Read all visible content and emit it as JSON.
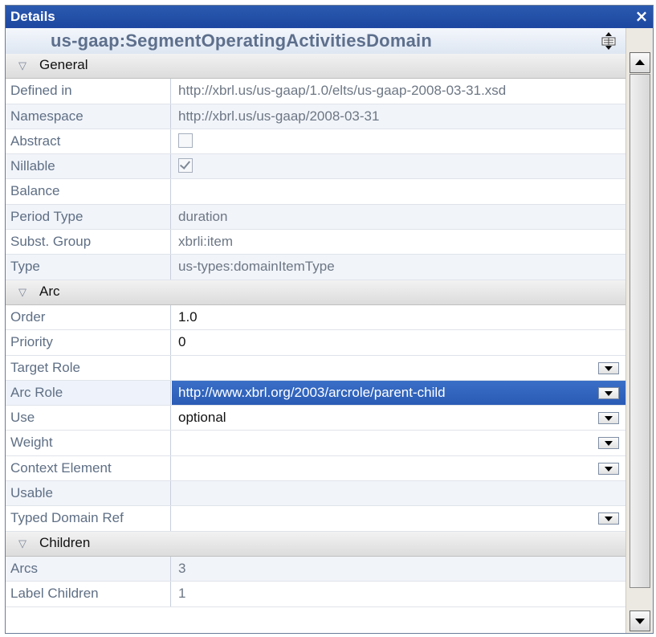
{
  "window": {
    "title": "Details",
    "close_glyph": "×"
  },
  "element_name": "us-gaap:SegmentOperatingActivitiesDomain",
  "groups": {
    "general": "General",
    "arc": "Arc",
    "children": "Children"
  },
  "general": {
    "defined_in": {
      "label": "Defined in",
      "value": "http://xbrl.us/us-gaap/1.0/elts/us-gaap-2008-03-31.xsd"
    },
    "namespace": {
      "label": "Namespace",
      "value": "http://xbrl.us/us-gaap/2008-03-31"
    },
    "abstract": {
      "label": "Abstract",
      "checked": false
    },
    "nillable": {
      "label": "Nillable",
      "checked": true
    },
    "balance": {
      "label": "Balance",
      "value": ""
    },
    "period_type": {
      "label": "Period Type",
      "value": "duration"
    },
    "subst_group": {
      "label": "Subst. Group",
      "value": "xbrli:item"
    },
    "type": {
      "label": "Type",
      "value": "us-types:domainItemType"
    }
  },
  "arc": {
    "order": {
      "label": "Order",
      "value": "1.0"
    },
    "priority": {
      "label": "Priority",
      "value": "0"
    },
    "target_role": {
      "label": "Target Role",
      "value": ""
    },
    "arc_role": {
      "label": "Arc Role",
      "value": "http://www.xbrl.org/2003/arcrole/parent-child"
    },
    "use": {
      "label": "Use",
      "value": "optional"
    },
    "weight": {
      "label": "Weight",
      "value": ""
    },
    "context_element": {
      "label": "Context Element",
      "value": ""
    },
    "usable": {
      "label": "Usable",
      "value": ""
    },
    "typed_domain_ref": {
      "label": "Typed Domain Ref",
      "value": ""
    }
  },
  "children": {
    "arcs": {
      "label": "Arcs",
      "value": "3"
    },
    "label_children": {
      "label": "Label Children",
      "value": "1"
    }
  },
  "icons": {
    "group_toggle": "triangle-down-icon",
    "header_toggle": "expand-collapse-icon",
    "dropdown": "dropdown-arrow-icon",
    "check": "checkmark-icon"
  },
  "colors": {
    "titlebar": "#2b5ab0",
    "selection": "#3a6fc7",
    "element_name": "#5d6f8c"
  }
}
